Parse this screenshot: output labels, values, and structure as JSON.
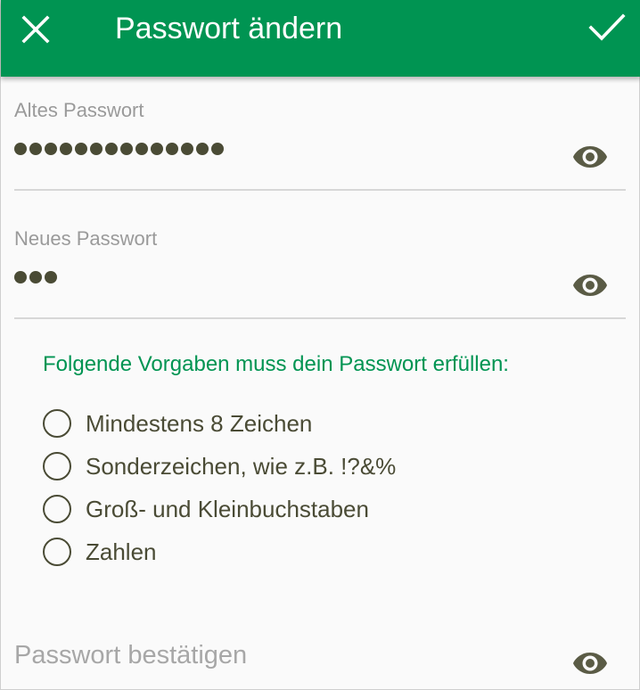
{
  "appbar": {
    "title": "Passwort ändern",
    "close_icon": "close-icon",
    "confirm_icon": "check-icon",
    "color": "#009452"
  },
  "old_password": {
    "label": "Altes Passwort",
    "masked_length": 14,
    "toggle_icon": "eye-icon"
  },
  "new_password": {
    "label": "Neues Passwort",
    "masked_length": 3,
    "toggle_icon": "eye-icon"
  },
  "requirements": {
    "heading": "Folgende Vorgaben muss dein Passwort erfüllen:",
    "items": [
      {
        "label": "Mindestens 8 Zeichen",
        "met": false
      },
      {
        "label": "Sonderzeichen, wie z.B. !?&%",
        "met": false
      },
      {
        "label": "Groß- und Kleinbuchstaben",
        "met": false
      },
      {
        "label": "Zahlen",
        "met": false
      }
    ]
  },
  "confirm_password": {
    "placeholder": "Passwort bestätigen",
    "toggle_icon": "eye-icon"
  }
}
